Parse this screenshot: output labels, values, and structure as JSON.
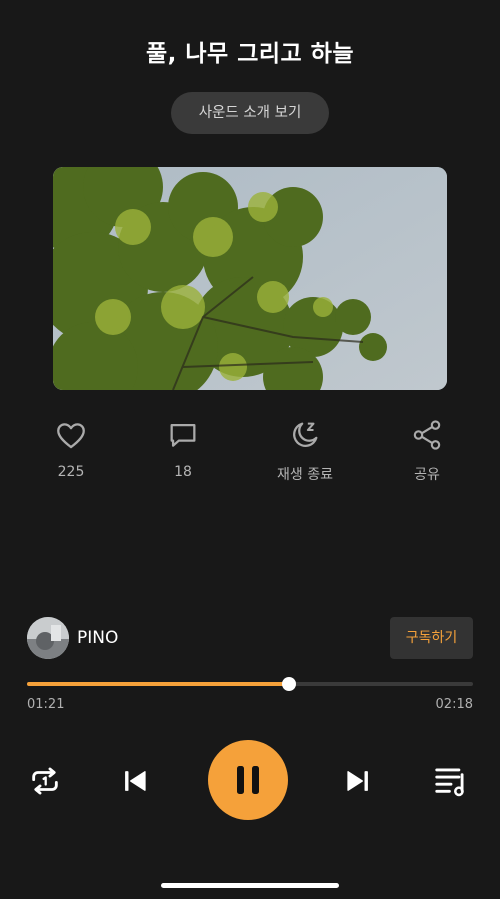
{
  "header": {
    "title": "풀, 나무 그리고 하늘",
    "intro_button": "사운드 소개 보기"
  },
  "artwork": {
    "description_icon": "tree-sky-artwork"
  },
  "actions": [
    {
      "icon": "heart-icon",
      "label": "225"
    },
    {
      "icon": "comment-icon",
      "label": "18"
    },
    {
      "icon": "sleep-timer-icon",
      "label": "재생 종료"
    },
    {
      "icon": "share-icon",
      "label": "공유"
    }
  ],
  "artist": {
    "name": "PINO",
    "subscribe_label": "구독하기"
  },
  "player": {
    "current_time": "01:21",
    "total_time": "02:18",
    "progress_fraction": 0.587,
    "state": "playing"
  },
  "colors": {
    "accent": "#f5a13a",
    "background": "#181818"
  }
}
